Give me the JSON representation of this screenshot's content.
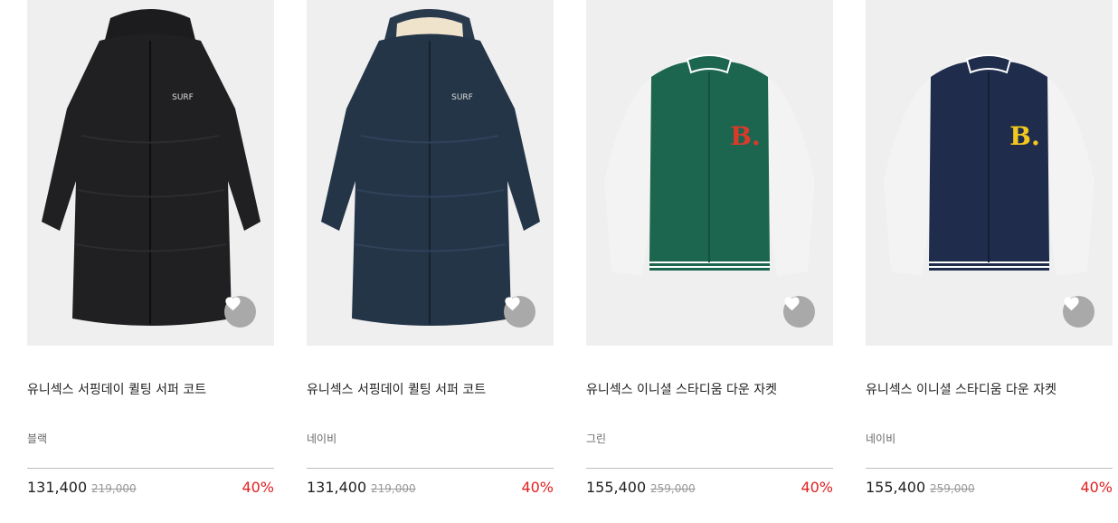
{
  "colors": {
    "discount": "#e02020",
    "wish_button": "#a9a9a9",
    "thumb_bg": "#efefef"
  },
  "products": [
    {
      "name": "유니섹스 서핑데이 퀼팅 서퍼 코트",
      "color": "블랙",
      "sale_price": "131,400",
      "original_price": "219,000",
      "discount": "40%",
      "image": "black-long-quilted-coat-image",
      "wish_icon": "heart-icon",
      "logo_text": "SURF"
    },
    {
      "name": "유니섹스 서핑데이 퀼팅 서퍼 코트",
      "color": "네이비",
      "sale_price": "131,400",
      "original_price": "219,000",
      "discount": "40%",
      "image": "navy-long-quilted-coat-image",
      "wish_icon": "heart-icon",
      "logo_text": "SURF"
    },
    {
      "name": "유니섹스 이니셜 스타디움 다운 자켓",
      "color": "그린",
      "sale_price": "155,400",
      "original_price": "259,000",
      "discount": "40%",
      "image": "green-varsity-down-jacket-image",
      "wish_icon": "heart-icon",
      "logo_text": "B."
    },
    {
      "name": "유니섹스 이니셜 스타디움 다운 자켓",
      "color": "네이비",
      "sale_price": "155,400",
      "original_price": "259,000",
      "discount": "40%",
      "image": "navy-varsity-down-jacket-image",
      "wish_icon": "heart-icon",
      "logo_text": "B."
    }
  ]
}
